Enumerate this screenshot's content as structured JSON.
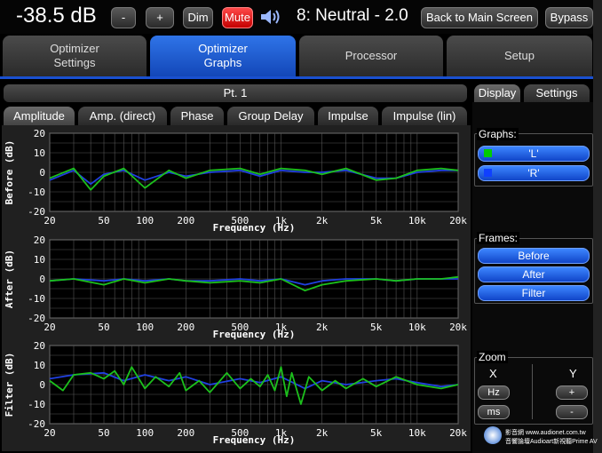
{
  "header": {
    "volume": "-38.5 dB",
    "minus_label": "-",
    "plus_label": "+",
    "dim_label": "Dim",
    "mute_label": "Mute",
    "preset": "8: Neutral - 2.0",
    "back_label": "Back to Main Screen",
    "bypass_label": "Bypass"
  },
  "tabs": [
    {
      "label": "Optimizer\nSettings"
    },
    {
      "label": "Optimizer\nGraphs"
    },
    {
      "label": "Processor"
    },
    {
      "label": "Setup"
    }
  ],
  "point_label": "Pt. 1",
  "subtabs": [
    "Amplitude",
    "Amp. (direct)",
    "Phase",
    "Group Delay",
    "Impulse",
    "Impulse (lin)"
  ],
  "right_tabs": [
    "Display",
    "Settings"
  ],
  "graphs_label": "Graphs:",
  "graph_buttons": [
    {
      "label": "'L'",
      "color": "#00cc00"
    },
    {
      "label": "'R'",
      "color": "#1040ff"
    }
  ],
  "frames_label": "Frames:",
  "frame_buttons": [
    "Before",
    "After",
    "Filter"
  ],
  "zoom": {
    "label": "Zoom",
    "x_label": "X",
    "y_label": "Y",
    "hz": "Hz",
    "ms": "ms",
    "plus": "+",
    "minus": "-"
  },
  "watermark": {
    "line1": "影音網 www.audionet.com.tw",
    "line2": "音響論壇Audioart新視聽Prime AV"
  },
  "colors": {
    "accent": "#1a50d0",
    "left": "#1cc01c",
    "right": "#2040e0",
    "mute": "#e00000"
  },
  "chart_data": [
    {
      "type": "line",
      "ylabel": "Before (dB)",
      "xlabel": "Frequency (Hz)",
      "x_scale": "log",
      "xlim": [
        20,
        20000
      ],
      "ylim": [
        -20,
        20
      ],
      "x_ticks": [
        "20",
        "50",
        "100",
        "200",
        "500",
        "1k",
        "2k",
        "5k",
        "10k",
        "20k"
      ],
      "y_ticks": [
        "20",
        "10",
        "0",
        "-10",
        "-20"
      ],
      "series": [
        {
          "name": "'L'",
          "x": [
            20,
            30,
            40,
            50,
            70,
            100,
            150,
            200,
            300,
            500,
            700,
            1000,
            1500,
            2000,
            3000,
            5000,
            7000,
            10000,
            15000,
            20000
          ],
          "values": [
            -3,
            2,
            -9,
            -2,
            2,
            -8,
            1,
            -3,
            1,
            2,
            -1,
            2,
            1,
            -1,
            2,
            -4,
            -3,
            1,
            2,
            1
          ]
        },
        {
          "name": "'R'",
          "x": [
            20,
            30,
            40,
            50,
            70,
            100,
            150,
            200,
            300,
            500,
            700,
            1000,
            1500,
            2000,
            3000,
            5000,
            7000,
            10000,
            15000,
            20000
          ],
          "values": [
            -4,
            1,
            -6,
            -1,
            1,
            -4,
            0,
            -2,
            0,
            1,
            -2,
            1,
            0,
            0,
            1,
            -3,
            -3,
            0,
            1,
            1
          ]
        }
      ]
    },
    {
      "type": "line",
      "ylabel": "After (dB)",
      "xlabel": "Frequency (Hz)",
      "x_scale": "log",
      "xlim": [
        20,
        20000
      ],
      "ylim": [
        -20,
        20
      ],
      "x_ticks": [
        "20",
        "50",
        "100",
        "200",
        "500",
        "1k",
        "2k",
        "5k",
        "10k",
        "20k"
      ],
      "y_ticks": [
        "20",
        "10",
        "0",
        "-10",
        "-20"
      ],
      "series": [
        {
          "name": "'L'",
          "x": [
            20,
            30,
            50,
            70,
            100,
            150,
            200,
            300,
            500,
            700,
            1000,
            1500,
            2000,
            3000,
            5000,
            7000,
            10000,
            15000,
            20000
          ],
          "values": [
            -1,
            0,
            -3,
            0,
            -2,
            0,
            -1,
            -2,
            -1,
            -2,
            0,
            -6,
            -3,
            -1,
            0,
            -1,
            0,
            0,
            1
          ]
        },
        {
          "name": "'R'",
          "x": [
            20,
            30,
            50,
            70,
            100,
            150,
            200,
            300,
            500,
            700,
            1000,
            1500,
            2000,
            3000,
            5000,
            7000,
            10000,
            15000,
            20000
          ],
          "values": [
            -1,
            0,
            -1,
            0,
            -1,
            0,
            -1,
            -1,
            0,
            -1,
            0,
            -3,
            -1,
            0,
            0,
            -1,
            0,
            0,
            0
          ]
        }
      ]
    },
    {
      "type": "line",
      "ylabel": "Filter (dB)",
      "xlabel": "Frequency (Hz)",
      "x_scale": "log",
      "xlim": [
        20,
        20000
      ],
      "ylim": [
        -20,
        20
      ],
      "x_ticks": [
        "20",
        "50",
        "100",
        "200",
        "500",
        "1k",
        "2k",
        "5k",
        "10k",
        "20k"
      ],
      "y_ticks": [
        "20",
        "10",
        "0",
        "-10",
        "-20"
      ],
      "series": [
        {
          "name": "'L'",
          "x": [
            20,
            25,
            30,
            40,
            50,
            60,
            70,
            80,
            100,
            120,
            150,
            180,
            200,
            250,
            300,
            400,
            500,
            600,
            700,
            800,
            900,
            1000,
            1100,
            1200,
            1400,
            1600,
            2000,
            2500,
            3000,
            4000,
            5000,
            7000,
            10000,
            15000,
            20000
          ],
          "values": [
            2,
            -3,
            5,
            6,
            3,
            7,
            0,
            9,
            -2,
            4,
            -1,
            6,
            -3,
            2,
            -4,
            6,
            -2,
            3,
            -1,
            5,
            -3,
            9,
            -6,
            6,
            -10,
            4,
            -3,
            2,
            -2,
            3,
            -1,
            4,
            0,
            -2,
            0
          ]
        },
        {
          "name": "'R'",
          "x": [
            20,
            30,
            50,
            70,
            100,
            150,
            200,
            300,
            500,
            700,
            1000,
            1500,
            2000,
            3000,
            5000,
            7000,
            10000,
            15000,
            20000
          ],
          "values": [
            3,
            5,
            6,
            2,
            5,
            2,
            4,
            0,
            3,
            1,
            4,
            -2,
            2,
            0,
            2,
            3,
            1,
            -1,
            0
          ]
        }
      ]
    }
  ]
}
